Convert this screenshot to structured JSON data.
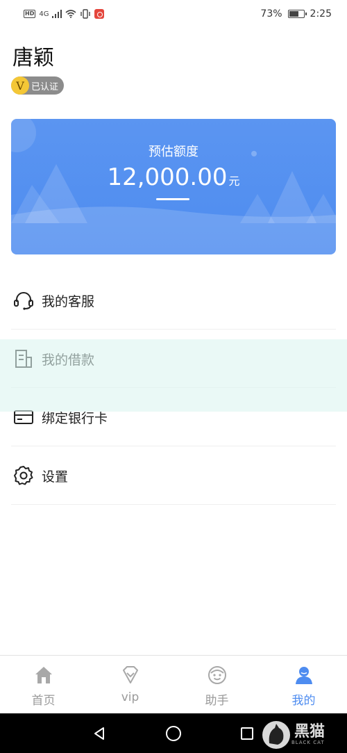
{
  "status_bar": {
    "network": "HD",
    "signal": "4G",
    "battery": "73%",
    "battery_level": 0.73,
    "time": "2:25"
  },
  "user": {
    "name": "唐颖",
    "badge_letter": "V",
    "badge_text": "已认证"
  },
  "credit": {
    "label": "预估额度",
    "amount": "12,000.00",
    "unit": "元",
    "card_color": "#5b95f1"
  },
  "menu": [
    {
      "label": "我的客服",
      "icon": "headset-icon"
    },
    {
      "label": "我的借款",
      "icon": "receipt-icon"
    },
    {
      "label": "绑定银行卡",
      "icon": "bank-card-icon"
    },
    {
      "label": "设置",
      "icon": "gear-icon"
    }
  ],
  "tabs": [
    {
      "label": "首页",
      "icon": "home-icon",
      "active": false
    },
    {
      "label": "vip",
      "icon": "diamond-icon",
      "active": false
    },
    {
      "label": "助手",
      "icon": "assistant-face-icon",
      "active": false
    },
    {
      "label": "我的",
      "icon": "person-icon",
      "active": true
    }
  ],
  "colors": {
    "accent": "#4e8cf0",
    "tab_inactive": "#9a9a9a"
  },
  "brand": {
    "name": "黑猫",
    "sub": "BLACK CAT"
  }
}
